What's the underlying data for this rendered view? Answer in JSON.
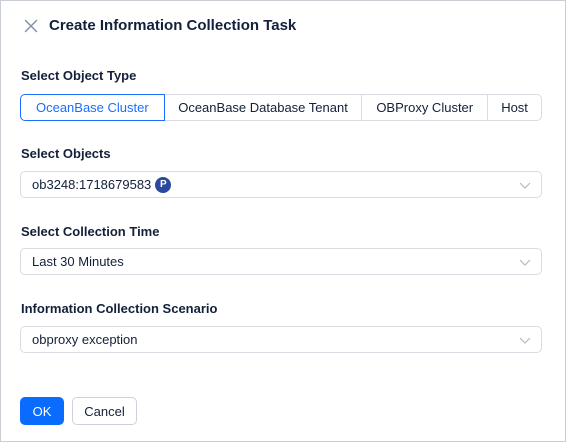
{
  "dialog": {
    "title": "Create Information Collection Task",
    "close_icon": "close-icon"
  },
  "object_type": {
    "label": "Select Object Type",
    "options": [
      "OceanBase Cluster",
      "OceanBase Database Tenant",
      "OBProxy Cluster",
      "Host"
    ],
    "selected": "OceanBase Cluster"
  },
  "objects": {
    "label": "Select Objects",
    "value": "ob3248:1718679583",
    "badge": "P"
  },
  "collection_time": {
    "label": "Select Collection Time",
    "value": "Last 30 Minutes"
  },
  "scenario": {
    "label": "Information Collection Scenario",
    "value": "obproxy exception"
  },
  "footer": {
    "ok_label": "OK",
    "cancel_label": "Cancel"
  },
  "colors": {
    "primary": "#0a6cff",
    "badge": "#2b4a9e",
    "text": "#132039",
    "border": "#d9dde3"
  }
}
